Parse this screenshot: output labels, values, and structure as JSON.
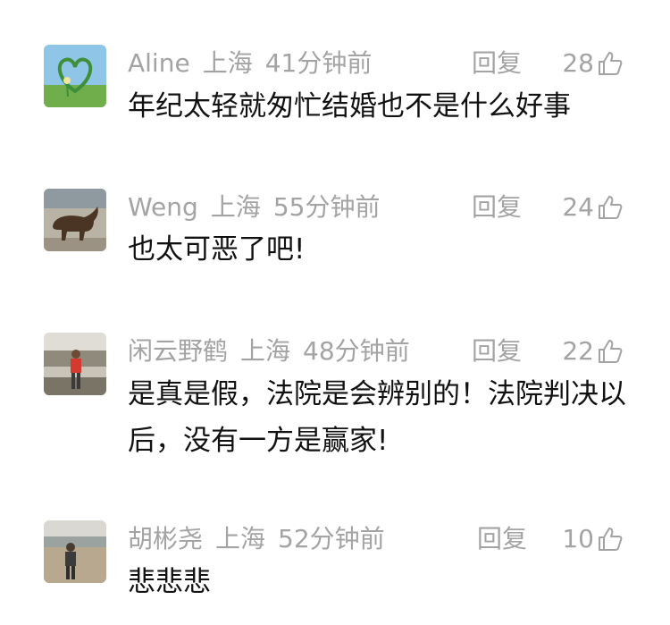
{
  "comments": [
    {
      "user": "Aline",
      "location": "上海",
      "time": "41分钟前",
      "reply_label": "回复",
      "likes": "28",
      "text": "年纪太轻就匆忙结婚也不是什么好事",
      "avatar_icon": "heart-clover-avatar-icon"
    },
    {
      "user": "Weng",
      "location": "上海",
      "time": "55分钟前",
      "reply_label": "回复",
      "likes": "24",
      "text": "也太可恶了吧!",
      "avatar_icon": "bull-statue-avatar-icon"
    },
    {
      "user": "闲云野鹤",
      "location": "上海",
      "time": "48分钟前",
      "reply_label": "回复",
      "likes": "22",
      "text": "是真是假，法院是会辨别的！法院判决以后，没有一方是赢家!",
      "avatar_icon": "person-outdoor-avatar-icon"
    },
    {
      "user": "胡彬尧",
      "location": "上海",
      "time": "52分钟前",
      "reply_label": "回复",
      "likes": "10",
      "text": "悲悲悲",
      "avatar_icon": "person-beach-avatar-icon"
    }
  ],
  "colors": {
    "meta": "#a3a3a3",
    "text": "#111111",
    "background": "#ffffff"
  }
}
